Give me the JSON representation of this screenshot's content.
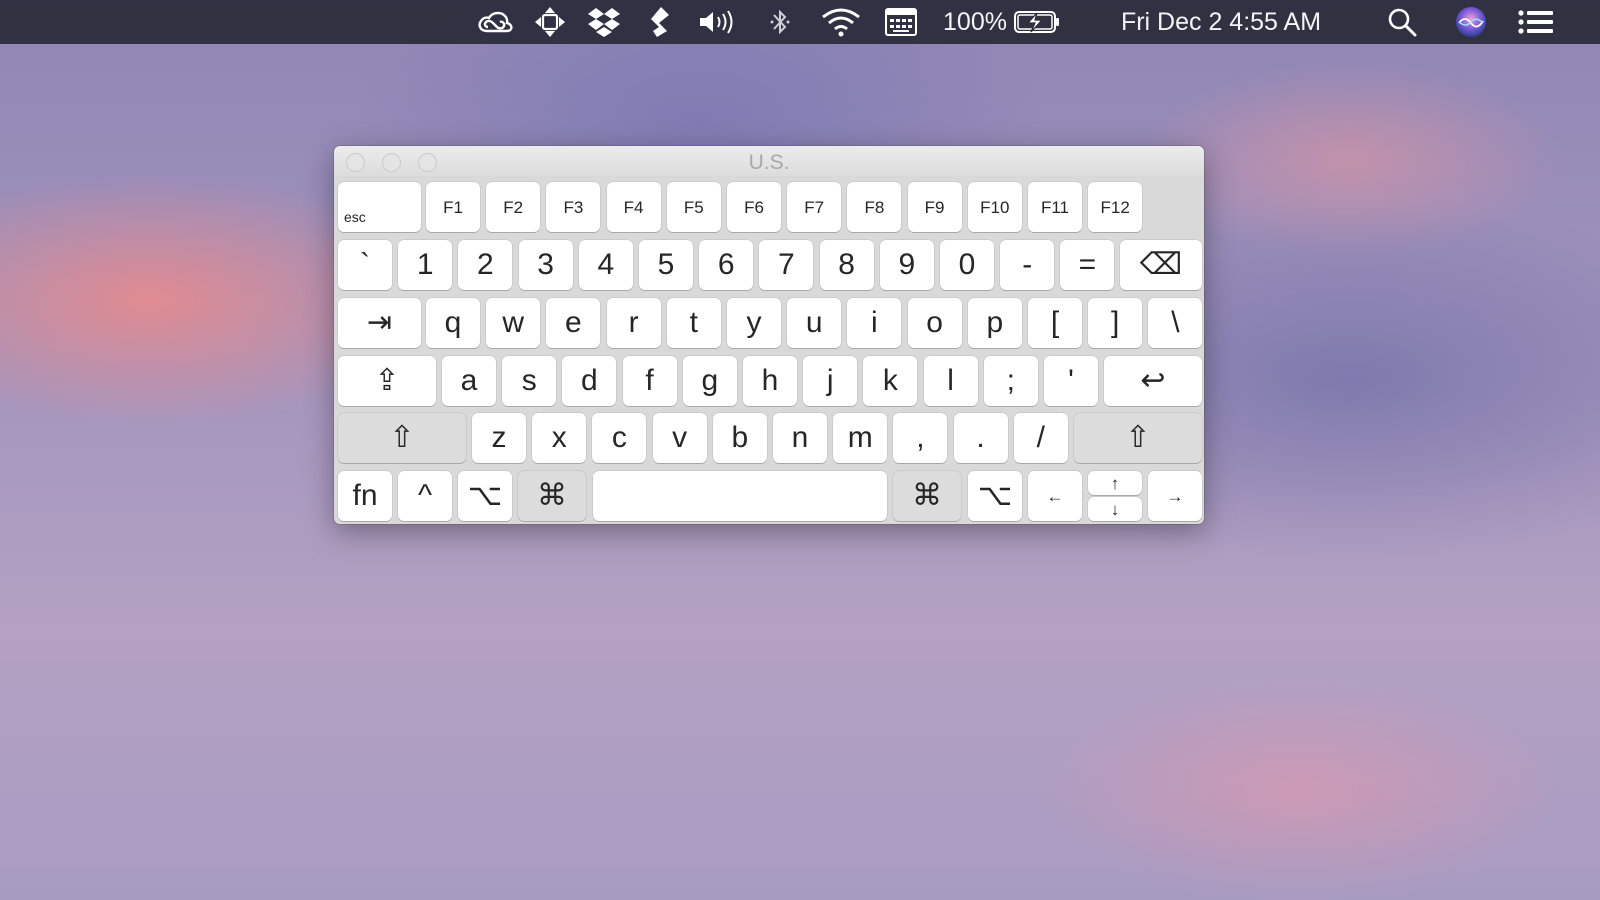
{
  "menubar": {
    "icons": [
      "creative-cloud-icon",
      "move-window-icon",
      "dropbox-icon",
      "evernote-icon",
      "volume-icon",
      "bluetooth-icon",
      "wifi-icon",
      "keyboard-viewer-icon",
      "battery-charging-icon",
      "spotlight-search-icon",
      "siri-icon",
      "notification-center-icon"
    ],
    "battery_percent": "100%",
    "clock": "Fri Dec 2  4:55 AM"
  },
  "window": {
    "title": "U.S."
  },
  "keyboard": {
    "fn_row": [
      "esc",
      "F1",
      "F2",
      "F3",
      "F4",
      "F5",
      "F6",
      "F7",
      "F8",
      "F9",
      "F10",
      "F11",
      "F12"
    ],
    "number_row": [
      "`",
      "1",
      "2",
      "3",
      "4",
      "5",
      "6",
      "7",
      "8",
      "9",
      "0",
      "-",
      "=",
      "⌫"
    ],
    "top_row": [
      "⇥",
      "q",
      "w",
      "e",
      "r",
      "t",
      "y",
      "u",
      "i",
      "o",
      "p",
      "[",
      "]",
      "\\"
    ],
    "home_row": [
      "⇪",
      "a",
      "s",
      "d",
      "f",
      "g",
      "h",
      "j",
      "k",
      "l",
      ";",
      "'",
      "↩"
    ],
    "bottom_row": [
      "⇧",
      "z",
      "x",
      "c",
      "v",
      "b",
      "n",
      "m",
      ",",
      ".",
      "/",
      "⇧"
    ],
    "modifier_row": [
      "fn",
      "^",
      "⌥",
      "⌘",
      "",
      "⌘",
      "⌥",
      "←",
      "↑",
      "↓",
      "→"
    ]
  }
}
